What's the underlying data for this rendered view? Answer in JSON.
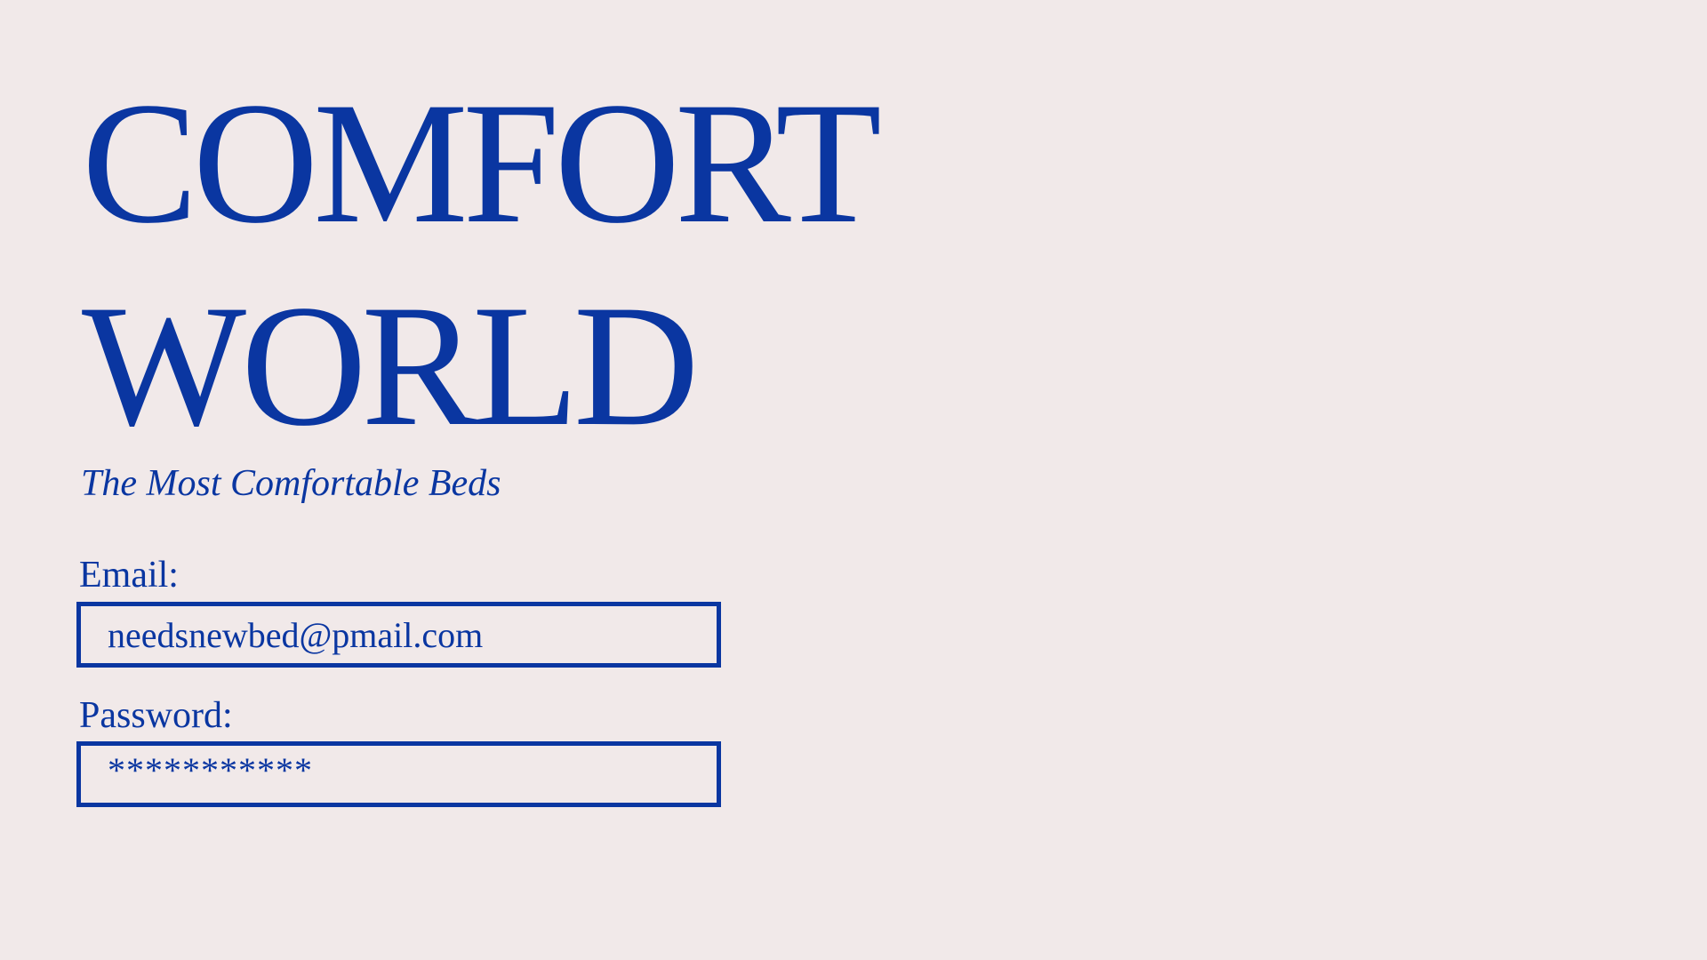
{
  "brand": {
    "title_line1": "COMFORT",
    "title_line2": "WORLD",
    "tagline": "The Most Comfortable Beds"
  },
  "login": {
    "email_label": "Email:",
    "email_value": "needsnewbed@pmail.com",
    "password_label": "Password:",
    "password_value": "***********"
  },
  "colors": {
    "background": "#f1e9e9",
    "accent": "#0a36a1"
  }
}
